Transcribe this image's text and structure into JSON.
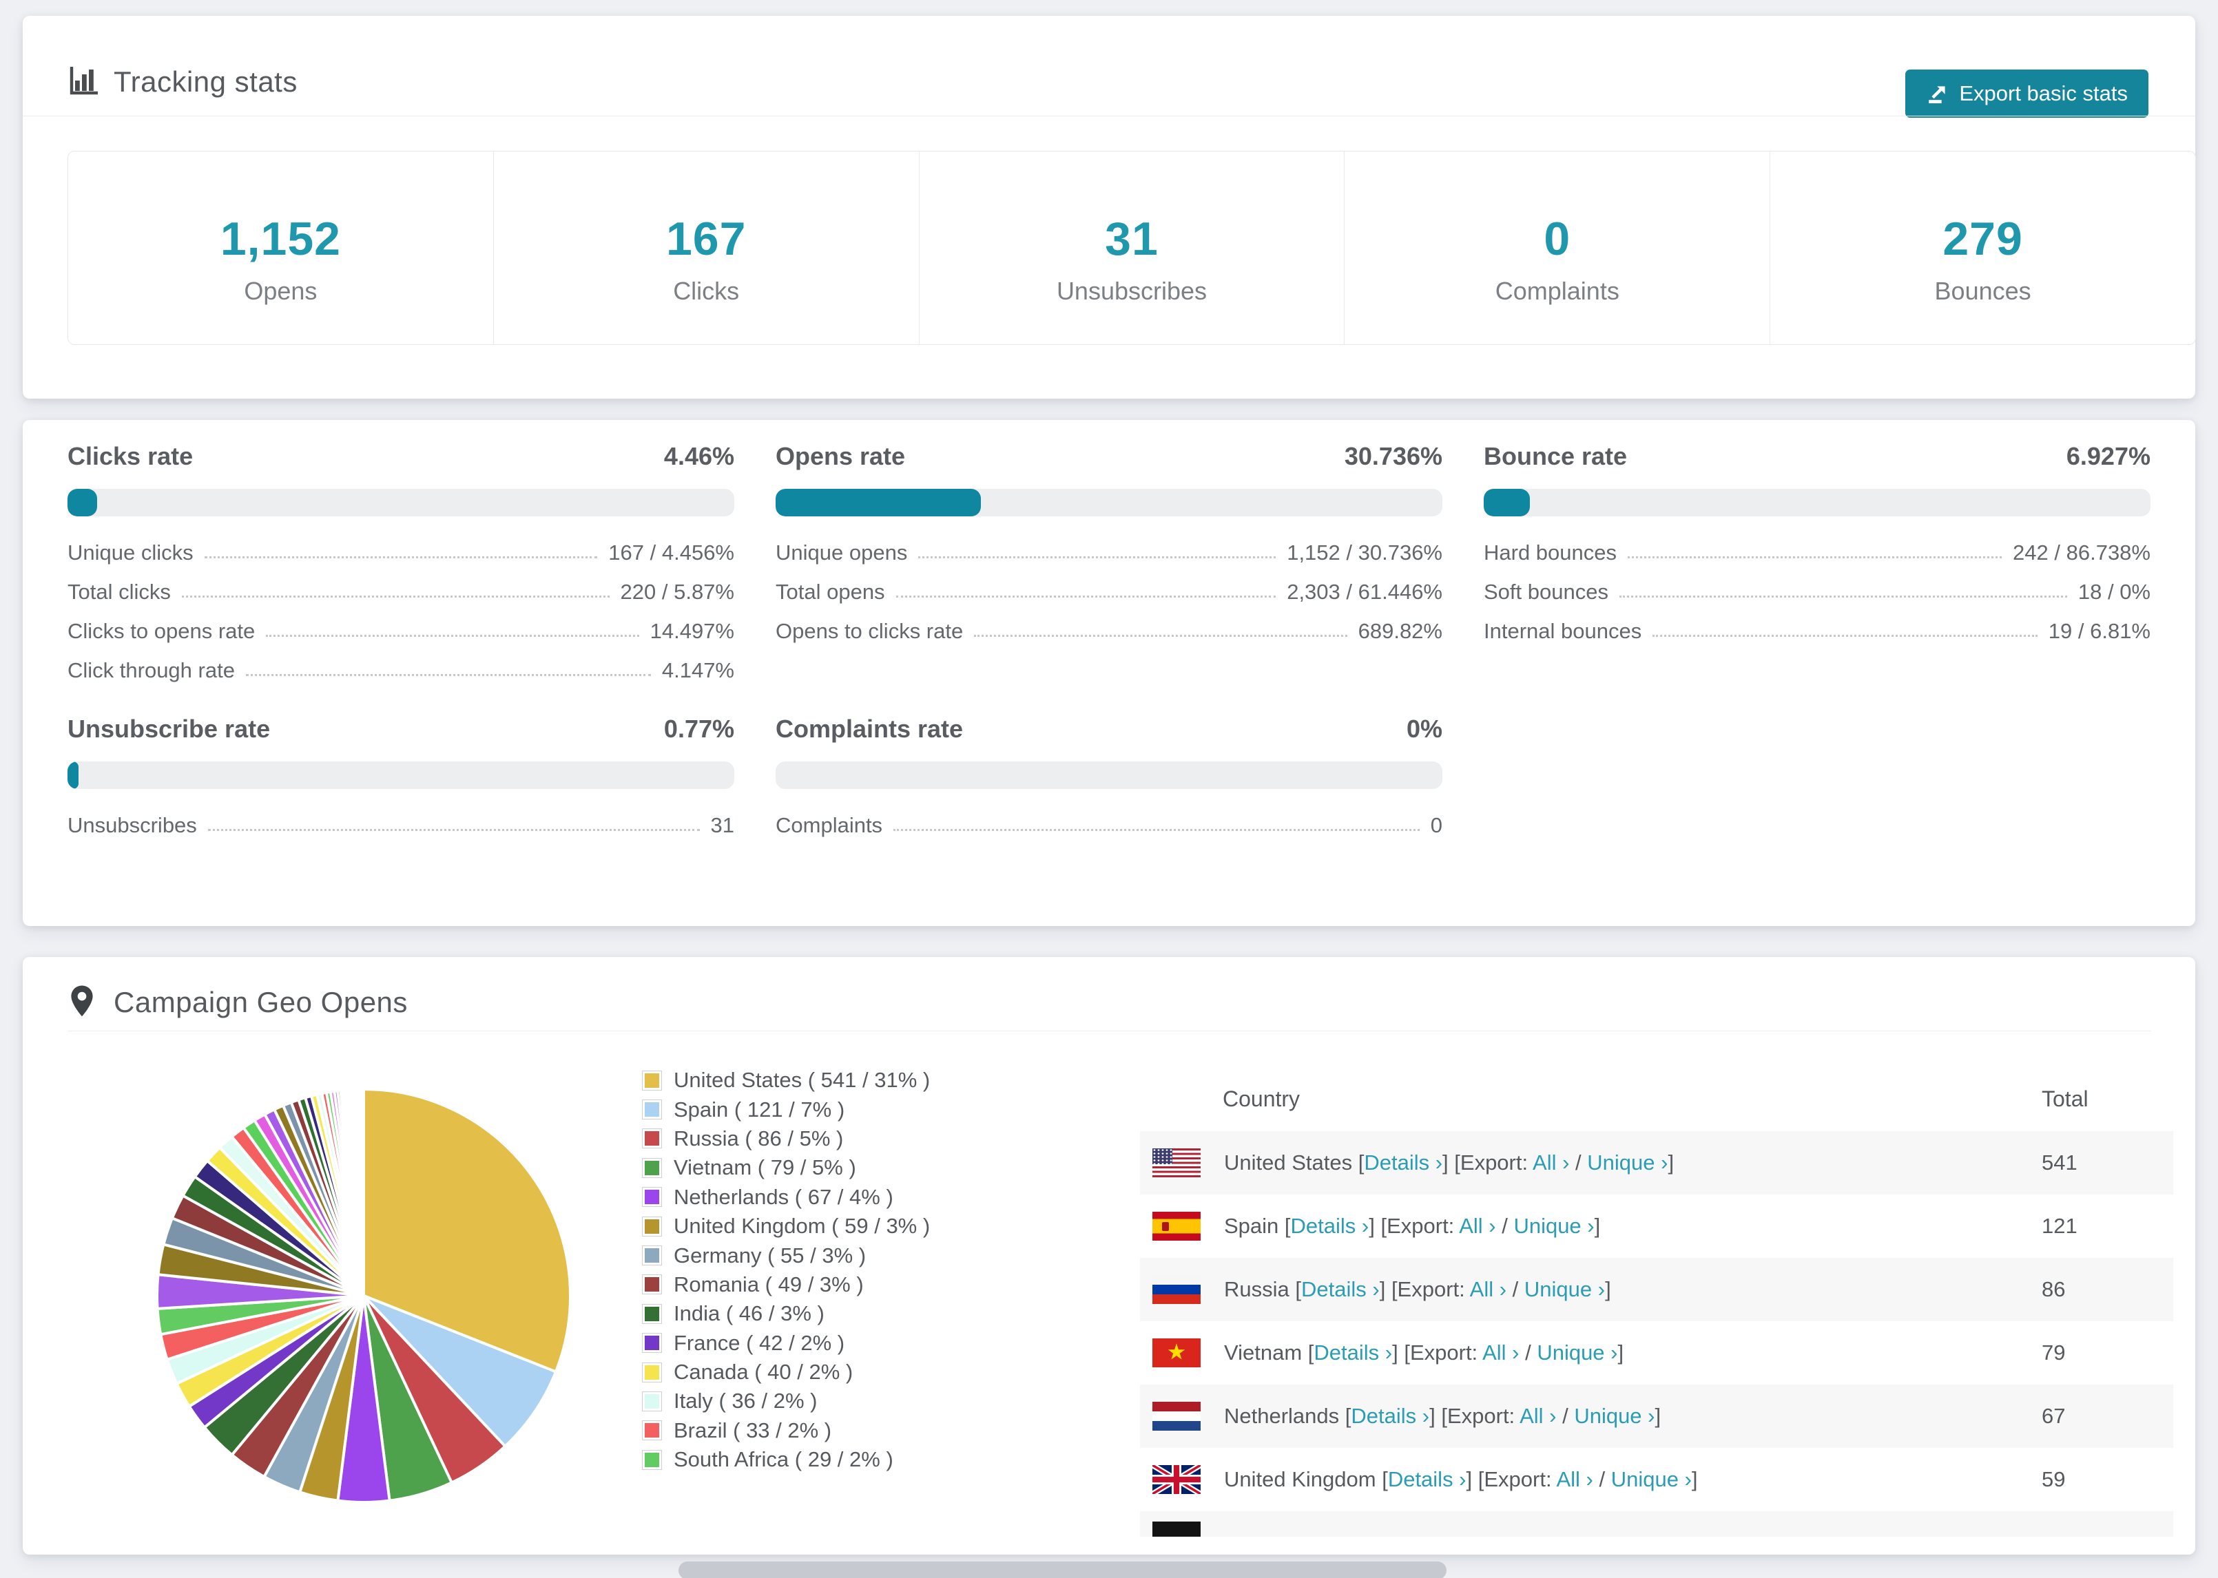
{
  "colors": {
    "teal_number": "#1f97ad",
    "teal_button": "#15859c",
    "teal_link": "#2a9db5",
    "bar_fill": "#0f87a0",
    "bar_track": "#eceef0",
    "page_bg": "#eef0f4"
  },
  "tracking_card": {
    "title": "Tracking stats",
    "export_button": "Export basic stats",
    "stats": [
      {
        "value": "1,152",
        "label": "Opens"
      },
      {
        "value": "167",
        "label": "Clicks"
      },
      {
        "value": "31",
        "label": "Unsubscribes"
      },
      {
        "value": "0",
        "label": "Complaints"
      },
      {
        "value": "279",
        "label": "Bounces"
      }
    ]
  },
  "rates_card": {
    "blocks": [
      {
        "title": "Clicks rate",
        "value": "4.46%",
        "bar_pct": 4.46,
        "rows": [
          {
            "label": "Unique clicks",
            "value": "167 / 4.456%"
          },
          {
            "label": "Total clicks",
            "value": "220 / 5.87%"
          },
          {
            "label": "Clicks to opens rate",
            "value": "14.497%"
          },
          {
            "label": "Click through rate",
            "value": "4.147%"
          }
        ]
      },
      {
        "title": "Opens rate",
        "value": "30.736%",
        "bar_pct": 30.736,
        "rows": [
          {
            "label": "Unique opens",
            "value": "1,152 / 30.736%"
          },
          {
            "label": "Total opens",
            "value": "2,303 / 61.446%"
          },
          {
            "label": "Opens to clicks rate",
            "value": "689.82%"
          }
        ]
      },
      {
        "title": "Bounce rate",
        "value": "6.927%",
        "bar_pct": 6.927,
        "rows": [
          {
            "label": "Hard bounces",
            "value": "242 / 86.738%"
          },
          {
            "label": "Soft bounces",
            "value": "18 / 0%"
          },
          {
            "label": "Internal bounces",
            "value": "19 / 6.81%"
          }
        ]
      },
      {
        "title": "Unsubscribe rate",
        "value": "0.77%",
        "bar_pct": 0.77,
        "rows": [
          {
            "label": "Unsubscribes",
            "value": "31"
          }
        ]
      },
      {
        "title": "Complaints rate",
        "value": "0%",
        "bar_pct": 0,
        "rows": [
          {
            "label": "Complaints",
            "value": "0"
          }
        ]
      }
    ]
  },
  "geo_card": {
    "title": "Campaign Geo Opens",
    "legend": [
      {
        "label": "United States ( 541 / 31% )",
        "color": "#e3bf4a"
      },
      {
        "label": "Spain ( 121 / 7% )",
        "color": "#abd2f3"
      },
      {
        "label": "Russia ( 86 / 5% )",
        "color": "#c8494d"
      },
      {
        "label": "Vietnam ( 79 / 5% )",
        "color": "#4da24b"
      },
      {
        "label": "Netherlands ( 67 / 4% )",
        "color": "#9a46ec"
      },
      {
        "label": "United Kingdom ( 59 / 3% )",
        "color": "#b6952d"
      },
      {
        "label": "Germany ( 55 / 3% )",
        "color": "#8ca9c0"
      },
      {
        "label": "Romania ( 49 / 3% )",
        "color": "#9d4040"
      },
      {
        "label": "India ( 46 / 3% )",
        "color": "#346f34"
      },
      {
        "label": "France ( 42 / 2% )",
        "color": "#7438c9"
      },
      {
        "label": "Canada ( 40 / 2% )",
        "color": "#f6e44e"
      },
      {
        "label": "Italy ( 36 / 2% )",
        "color": "#d9fbf4"
      },
      {
        "label": "Brazil ( 33 / 2% )",
        "color": "#f4605f"
      },
      {
        "label": "South Africa ( 29 / 2% )",
        "color": "#62cb62"
      }
    ],
    "table": {
      "headers": {
        "country": "Country",
        "total": "Total"
      },
      "fmt": {
        "open": "[",
        "close": "]",
        "details": "Details ›",
        "export_prefix": "[Export:",
        "all": "All ›",
        "slash": "/",
        "unique": "Unique ›"
      },
      "rows": [
        {
          "country": "United States",
          "flag": "us",
          "total": "541"
        },
        {
          "country": "Spain",
          "flag": "es",
          "total": "121"
        },
        {
          "country": "Russia",
          "flag": "ru",
          "total": "86"
        },
        {
          "country": "Vietnam",
          "flag": "vn",
          "total": "79"
        },
        {
          "country": "Netherlands",
          "flag": "nl",
          "total": "67"
        },
        {
          "country": "United Kingdom",
          "flag": "gb",
          "total": "59"
        },
        {
          "country": "",
          "flag": "de",
          "total": "",
          "partial": true
        }
      ]
    }
  },
  "chart_data": {
    "type": "pie",
    "title": "Campaign Geo Opens",
    "legend_position": "right",
    "slices": [
      {
        "label": "United States",
        "value": 541,
        "pct": 31,
        "color": "#e3bf4a"
      },
      {
        "label": "Spain",
        "value": 121,
        "pct": 7,
        "color": "#abd2f3"
      },
      {
        "label": "Russia",
        "value": 86,
        "pct": 5,
        "color": "#c8494d"
      },
      {
        "label": "Vietnam",
        "value": 79,
        "pct": 5,
        "color": "#4da24b"
      },
      {
        "label": "Netherlands",
        "value": 67,
        "pct": 4,
        "color": "#9a46ec"
      },
      {
        "label": "United Kingdom",
        "value": 59,
        "pct": 3,
        "color": "#b6952d"
      },
      {
        "label": "Germany",
        "value": 55,
        "pct": 3,
        "color": "#8ca9c0"
      },
      {
        "label": "Romania",
        "value": 49,
        "pct": 3,
        "color": "#9d4040"
      },
      {
        "label": "India",
        "value": 46,
        "pct": 3,
        "color": "#346f34"
      },
      {
        "label": "France",
        "value": 42,
        "pct": 2,
        "color": "#7438c9"
      },
      {
        "label": "Canada",
        "value": 40,
        "pct": 2,
        "color": "#f6e44e"
      },
      {
        "label": "Italy",
        "value": 36,
        "pct": 2,
        "color": "#d9fbf4"
      },
      {
        "label": "Brazil",
        "value": 33,
        "pct": 2,
        "color": "#f4605f"
      },
      {
        "label": "South Africa",
        "value": 29,
        "pct": 2,
        "color": "#62cb62"
      }
    ],
    "tail": {
      "note": "long tail of unlabeled small countries",
      "pct": 26,
      "count": 42,
      "decay": 0.9,
      "palette": [
        "#a45ce8",
        "#8f7a23",
        "#7b94a9",
        "#8d3b3b",
        "#2f6f2f",
        "#35287d",
        "#f6e84b",
        "#e3fbf5",
        "#f4605f",
        "#5bd05b",
        "#e35de3"
      ]
    }
  }
}
